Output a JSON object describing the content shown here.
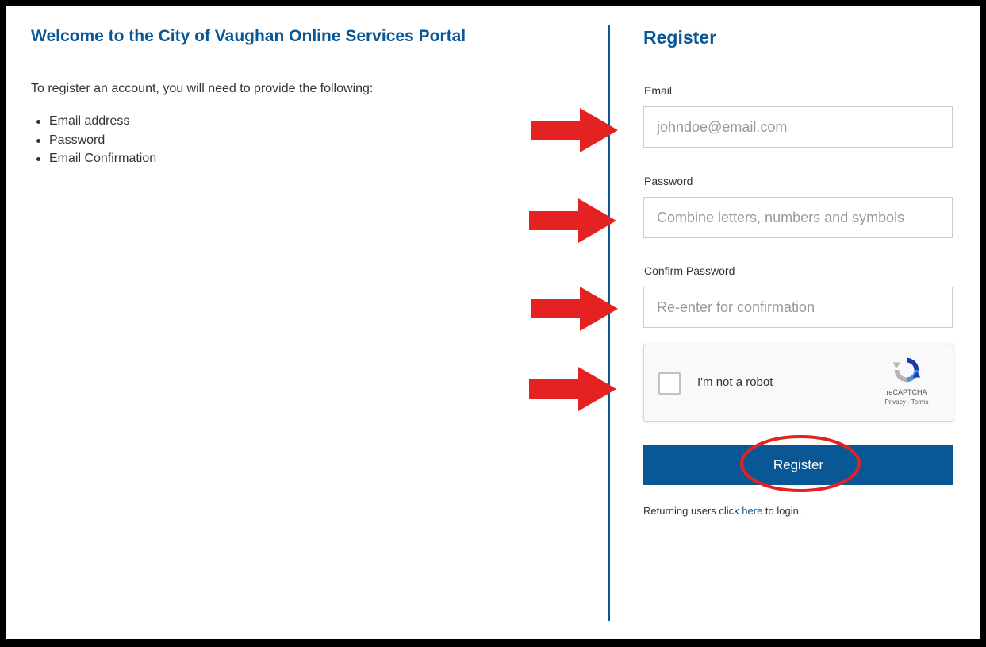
{
  "left": {
    "title": "Welcome to the City of Vaughan Online Services Portal",
    "intro": "To register an account, you will need to provide the following:",
    "requirements": [
      "Email address",
      "Password",
      "Email Confirmation"
    ]
  },
  "form": {
    "title": "Register",
    "email": {
      "label": "Email",
      "placeholder": "johndoe@email.com"
    },
    "password": {
      "label": "Password",
      "placeholder": "Combine letters, numbers and symbols"
    },
    "confirm": {
      "label": "Confirm Password",
      "placeholder": "Re-enter for confirmation"
    },
    "recaptcha": {
      "text": "I'm not a robot",
      "brand": "reCAPTCHA",
      "privacy": "Privacy",
      "separator": " - ",
      "terms": "Terms"
    },
    "submit_label": "Register",
    "footer": {
      "before": "Returning users click ",
      "link": "here",
      "after": " to login."
    }
  },
  "colors": {
    "brand_blue": "#0a5796",
    "annotation_red": "#e52222"
  },
  "annotations": {
    "arrow_icon": "red-arrow-right",
    "circle_icon": "red-ellipse-highlight"
  }
}
